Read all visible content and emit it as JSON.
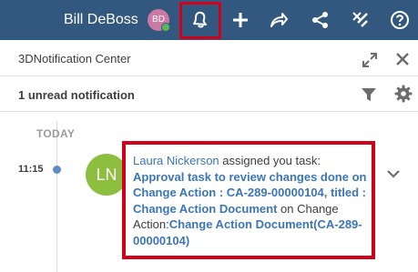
{
  "topbar": {
    "user_name": "Bill DeBoss",
    "avatar_initials": "BD",
    "icons": [
      "bell-icon",
      "plus-icon",
      "share-icon",
      "network-icon",
      "tools-icon",
      "help-icon"
    ]
  },
  "panel": {
    "title": "3DNotification Center",
    "unread_text": "1 unread notification",
    "section_label": "TODAY"
  },
  "notification": {
    "time": "11:15",
    "sender_initials": "LN",
    "sender_name": "Laura Nickerson",
    "action_text": " assigned you task: ",
    "task_title": "Approval task to review changes done on Change Action : CA-289-00000104, titled : Change Action Document",
    "on_text": " on Change Action:",
    "change_action": "Change Action Document(CA-289-00000104)"
  },
  "colors": {
    "topbar": "#33587f",
    "highlight": "#d0021b",
    "link": "#3b76b6",
    "sender_avatar": "#8cbf3f",
    "user_avatar": "#c979a3"
  }
}
